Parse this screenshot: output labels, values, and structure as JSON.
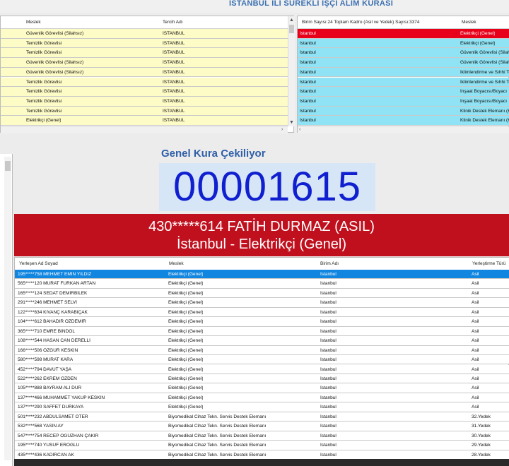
{
  "title": "İSTANBUL İLİ SÜREKLİ İŞÇİ ALIM KURASI",
  "left_table": {
    "headers": [
      "Meslek",
      "Tercih Adı"
    ],
    "rows": [
      [
        "Güvenlik Görevlisi (Silahsız)",
        "İSTANBUL"
      ],
      [
        "Temizlik Görevlisi",
        "İSTANBUL"
      ],
      [
        "Temizlik Görevlisi",
        "İSTANBUL"
      ],
      [
        "Güvenlik Görevlisi (Silahsız)",
        "İSTANBUL"
      ],
      [
        "Güvenlik Görevlisi (Silahsız)",
        "İSTANBUL"
      ],
      [
        "Temizlik Görevlisi",
        "İSTANBUL"
      ],
      [
        "Temizlik Görevlisi",
        "İSTANBUL"
      ],
      [
        "Temizlik Görevlisi",
        "İSTANBUL"
      ],
      [
        "Temizlik Görevlisi",
        "İSTANBUL"
      ],
      [
        "Elektrikçi (Genel)",
        "İSTANBUL"
      ]
    ]
  },
  "right_table": {
    "headers": [
      "Birim Sayısı:24 Toplam Kadro (Asil ve Yedek) Sayısı:3374",
      "Meslek"
    ],
    "rows": [
      [
        "İstanbul",
        "Elektrikçi (Genel)"
      ],
      [
        "İstanbul",
        "Elektrikçi (Genel)"
      ],
      [
        "İstanbul",
        "Güvenlik Görevlisi (Silah"
      ],
      [
        "İstanbul",
        "Güvenlik Görevlisi (Silah"
      ],
      [
        "İstanbul",
        "İklimlendirme ve Sıhhi Tesisatçı"
      ],
      [
        "İstanbul",
        "İklimlendirme ve Sıhhi Tesisatçı"
      ],
      [
        "İstanbul",
        "İnşaat Boyacısı/Boyacı"
      ],
      [
        "İstanbul",
        "İnşaat Boyacısı/Boyacı"
      ],
      [
        "İstanbul",
        "Klinik Destek Elemanı (H"
      ],
      [
        "İstanbul",
        "Klinik Destek Elemanı (H"
      ]
    ]
  },
  "draw": {
    "label": "Genel Kura Çekiliyor",
    "number": "00001615",
    "winner_line1": "430*****614 FATİH DURMAZ (ASIL)",
    "winner_line2": "İstanbul - Elektrikçi (Genel)"
  },
  "results_table": {
    "headers": [
      "Yerleşen Ad Soyad",
      "Meslek",
      "Birim Adı",
      "Yerleştirme Türü"
    ],
    "rows": [
      [
        "195*****758 MEHMET EMİN YILDIZ",
        "Elektrikçi (Genel)",
        "İstanbul",
        "Asil"
      ],
      [
        "565*****120 MURAT FURKAN ARTAN",
        "Elektrikçi (Genel)",
        "İstanbul",
        "Asil"
      ],
      [
        "165*****124 SEDAT DEMİRBİLEK",
        "Elektrikçi (Genel)",
        "İstanbul",
        "Asil"
      ],
      [
        "291*****246 MEHMET SELVİ",
        "Elektrikçi (Genel)",
        "İstanbul",
        "Asil"
      ],
      [
        "122*****634 KIVANÇ KARABIÇAK",
        "Elektrikçi (Genel)",
        "İstanbul",
        "Asil"
      ],
      [
        "104*****612 BAHADIR ÖZDEMİR",
        "Elektrikçi (Genel)",
        "İstanbul",
        "Asil"
      ],
      [
        "365*****710 EMRE BİNDÖL",
        "Elektrikçi (Genel)",
        "İstanbul",
        "Asil"
      ],
      [
        "108*****544 HASAN CAN DERELLİ",
        "Elektrikçi (Genel)",
        "İstanbul",
        "Asil"
      ],
      [
        "166*****506 ÖZGÜR KESKİN",
        "Elektrikçi (Genel)",
        "İstanbul",
        "Asil"
      ],
      [
        "580*****598 MURAT KARA",
        "Elektrikçi (Genel)",
        "İstanbul",
        "Asil"
      ],
      [
        "452*****794 DAVUT YAŞA",
        "Elektrikçi (Genel)",
        "İstanbul",
        "Asil"
      ],
      [
        "522*****262 EKREM ÖZDEN",
        "Elektrikçi (Genel)",
        "İstanbul",
        "Asil"
      ],
      [
        "105*****888 BAYRAM ALİ DUR",
        "Elektrikçi (Genel)",
        "İstanbul",
        "Asil"
      ],
      [
        "137*****466 MUHAMMET YAKUP KESKİN",
        "Elektrikçi (Genel)",
        "İstanbul",
        "Asil"
      ],
      [
        "137*****290 SAFFET DURKAYA",
        "Elektrikçi (Genel)",
        "İstanbul",
        "Asil"
      ],
      [
        "501*****232 ABDULSAMET ÖTER",
        "Biyomedikal Cihaz Tekn. Servis Destek Elemanı",
        "İstanbul",
        "32.Yedek"
      ],
      [
        "532*****568 YASİN AY",
        "Biyomedikal Cihaz Tekn. Servis Destek Elemanı",
        "İstanbul",
        "31.Yedek"
      ],
      [
        "547*****754 RECEP OĞUZHAN ÇAKIR",
        "Biyomedikal Cihaz Tekn. Servis Destek Elemanı",
        "İstanbul",
        "30.Yedek"
      ],
      [
        "195*****740 YUSUF EROĞLU",
        "Biyomedikal Cihaz Tekn. Servis Destek Elemanı",
        "İstanbul",
        "29.Yedek"
      ],
      [
        "435*****436 KADİRCAN AK",
        "Biyomedikal Cihaz Tekn. Servis Destek Elemanı",
        "İstanbul",
        "28.Yedek"
      ]
    ]
  },
  "colors": {
    "left_row_bg": "#fdfbc6",
    "right_row_bg": "#8fe3f4",
    "selected_red": "#e8001b",
    "selected_blue": "#1186e0",
    "banner": "#c0101e",
    "counter_text": "#1020d0"
  }
}
